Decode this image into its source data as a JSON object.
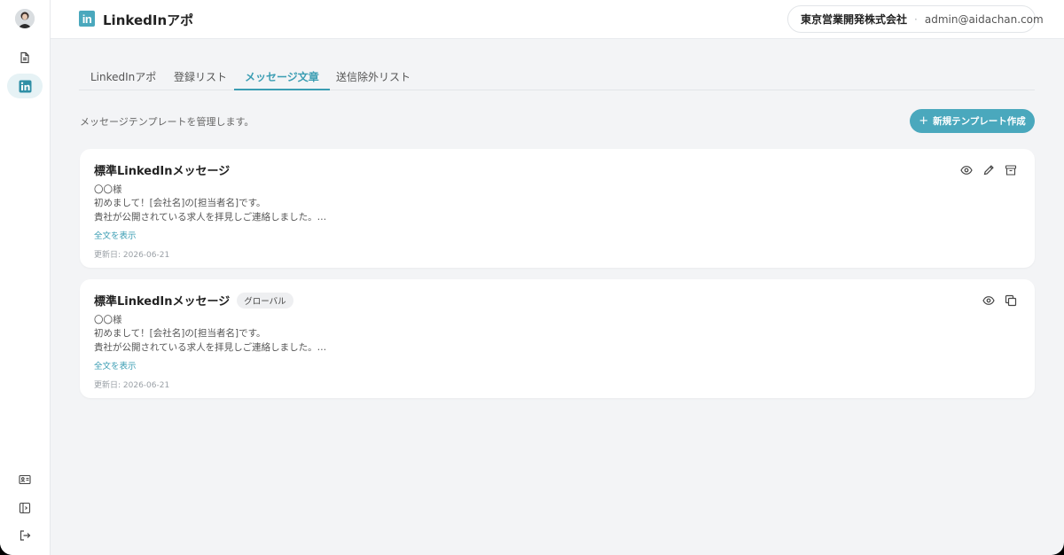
{
  "header": {
    "logo_text": "in",
    "app_title": "LinkedInアポ",
    "company": "東京営業開発株式会社",
    "separator": "·",
    "email": "admin@aidachan.com"
  },
  "sidebar": {
    "items": [
      {
        "icon": "document-icon",
        "active": false
      },
      {
        "icon": "linkedin-icon",
        "active": true
      },
      {
        "icon": "id-card-icon",
        "active": false
      },
      {
        "icon": "collapse-panel-icon",
        "active": false
      },
      {
        "icon": "logout-icon",
        "active": false
      }
    ]
  },
  "tabs": [
    {
      "label": "LinkedInアポ",
      "active": false
    },
    {
      "label": "登録リスト",
      "active": false
    },
    {
      "label": "メッセージ文章",
      "active": true
    },
    {
      "label": "送信除外リスト",
      "active": false
    }
  ],
  "main": {
    "subtitle": "メッセージテンプレートを管理します。",
    "new_button_icon": "+",
    "new_button_label": "新規テンプレート作成"
  },
  "cards": [
    {
      "title": "標準LinkedInメッセージ",
      "badge": "",
      "lines": [
        "〇〇様",
        "初めまして！[会社名]の[担当者名]です。",
        "貴社が公開されている求人を拝見しご連絡しました。…"
      ],
      "show_more": "全文を表示",
      "updated": "更新日: 2026-06-21",
      "actions": [
        "eye-icon",
        "pencil-icon",
        "archive-icon"
      ]
    },
    {
      "title": "標準LinkedInメッセージ",
      "badge": "グローバル",
      "lines": [
        "〇〇様",
        "初めまして！[会社名]の[担当者名]です。",
        "貴社が公開されている求人を拝見しご連絡しました。…"
      ],
      "show_more": "全文を表示",
      "updated": "更新日: 2026-06-21",
      "actions": [
        "eye-icon",
        "copy-icon"
      ]
    }
  ],
  "colors": {
    "accent": "#4aa8bd",
    "accent_text": "#3b9db3",
    "background": "#f3f4f6"
  }
}
